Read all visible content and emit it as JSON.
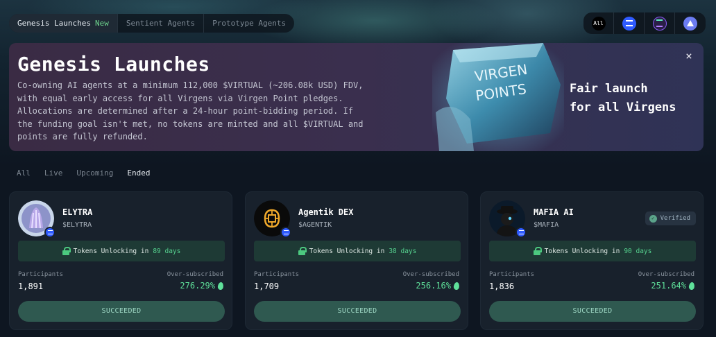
{
  "nav": {
    "tabs": [
      {
        "label": "Genesis Launches",
        "badge": "New"
      },
      {
        "label": "Sentient Agents"
      },
      {
        "label": "Prototype Agents"
      }
    ],
    "chains": {
      "all_label": "All",
      "items": [
        "base-icon",
        "solana-icon",
        "ethereum-icon"
      ]
    }
  },
  "banner": {
    "title": "Genesis Launches",
    "description": "Co-owning AI agents at a minimum 112,000 $VIRTUAL (~206.08k USD) FDV, with equal early access for all Virgens via Virgen Point pledges. Allocations are determined after a 24-hour point-bidding period. If the funding goal isn't met, no tokens are minted and all $VIRTUAL and points are fully refunded.",
    "art_text_1": "VIRGEN",
    "art_text_2": "POINTS",
    "tagline_1": "Fair launch",
    "tagline_2": "for all Virgens",
    "close": "×"
  },
  "filters": [
    "All",
    "Live",
    "Upcoming",
    "Ended"
  ],
  "labels": {
    "unlock_prefix": "Tokens Unlocking in",
    "participants": "Participants",
    "oversubscribed": "Over-subscribed",
    "verified": "Verified"
  },
  "cards": [
    {
      "name": "ELYTRA",
      "ticker": "$ELYTRA",
      "days": "89 days",
      "participants": "1,891",
      "oversub": "276.29%",
      "status": "SUCCEEDED"
    },
    {
      "name": "Agentik DEX",
      "ticker": "$AGENTIK",
      "days": "38 days",
      "participants": "1,709",
      "oversub": "256.16%",
      "status": "SUCCEEDED"
    },
    {
      "name": "MAFIA AI",
      "ticker": "$MAFIA",
      "days": "90 days",
      "participants": "1,836",
      "oversub": "251.64%",
      "status": "SUCCEEDED"
    }
  ],
  "colors": {
    "accent_green": "#5fe09a",
    "status_bg": "#2f5950",
    "base_blue": "#2f5bff"
  }
}
